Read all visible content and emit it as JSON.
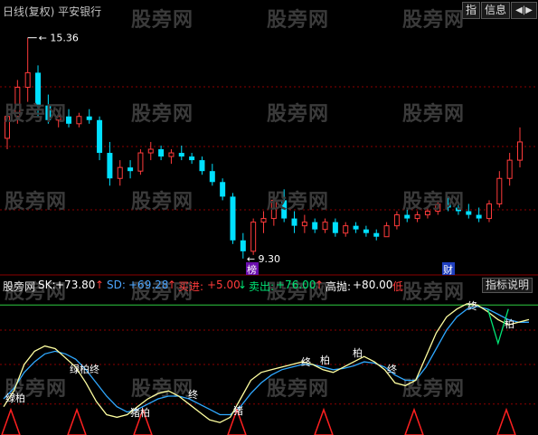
{
  "toolbar": {
    "title": "日线(复权)  平安银行",
    "index_button": "指",
    "info_button": "信息",
    "arrows_button": "◀|▶"
  },
  "watermark": "股旁网",
  "price_chart": {
    "high_label": "15.36",
    "low_label": "9.30",
    "tag_bang": "榜",
    "tag_cai": "财",
    "up_color": "#ff3b3b",
    "down_color": "#00e0ff",
    "candles": [
      [
        12.6,
        13.5,
        12.3,
        13.2
      ],
      [
        13.2,
        14.2,
        13.0,
        14.0
      ],
      [
        14.0,
        15.36,
        13.6,
        14.4
      ],
      [
        14.4,
        14.6,
        13.2,
        13.5
      ],
      [
        13.5,
        13.8,
        13.0,
        13.1
      ],
      [
        13.1,
        13.3,
        12.9,
        13.2
      ],
      [
        13.2,
        13.4,
        12.9,
        13.0
      ],
      [
        13.0,
        13.3,
        12.9,
        13.2
      ],
      [
        13.2,
        13.4,
        13.0,
        13.1
      ],
      [
        13.1,
        13.2,
        12.0,
        12.2
      ],
      [
        12.2,
        12.5,
        11.3,
        11.5
      ],
      [
        11.5,
        12.0,
        11.3,
        11.8
      ],
      [
        11.8,
        12.0,
        11.5,
        11.7
      ],
      [
        11.7,
        12.3,
        11.6,
        12.2
      ],
      [
        12.2,
        12.5,
        12.0,
        12.3
      ],
      [
        12.3,
        12.4,
        12.0,
        12.1
      ],
      [
        12.1,
        12.3,
        11.9,
        12.2
      ],
      [
        12.2,
        12.4,
        12.0,
        12.1
      ],
      [
        12.1,
        12.2,
        11.9,
        12.0
      ],
      [
        12.0,
        12.1,
        11.6,
        11.7
      ],
      [
        11.7,
        11.9,
        11.3,
        11.4
      ],
      [
        11.4,
        11.5,
        10.9,
        11.0
      ],
      [
        11.0,
        11.1,
        9.7,
        9.8
      ],
      [
        9.8,
        10.0,
        9.3,
        9.5
      ],
      [
        9.5,
        10.4,
        9.4,
        10.3
      ],
      [
        10.3,
        10.6,
        10.0,
        10.4
      ],
      [
        10.4,
        11.0,
        10.2,
        10.9
      ],
      [
        10.9,
        11.2,
        10.3,
        10.4
      ],
      [
        10.4,
        10.6,
        10.0,
        10.2
      ],
      [
        10.2,
        10.5,
        10.0,
        10.3
      ],
      [
        10.3,
        10.4,
        10.0,
        10.1
      ],
      [
        10.1,
        10.4,
        10.0,
        10.3
      ],
      [
        10.3,
        10.4,
        9.9,
        10.0
      ],
      [
        10.0,
        10.3,
        9.9,
        10.2
      ],
      [
        10.2,
        10.3,
        10.0,
        10.1
      ],
      [
        10.1,
        10.2,
        9.9,
        10.0
      ],
      [
        10.0,
        10.1,
        9.8,
        9.9
      ],
      [
        9.9,
        10.3,
        9.9,
        10.2
      ],
      [
        10.2,
        10.6,
        10.1,
        10.5
      ],
      [
        10.5,
        10.7,
        10.3,
        10.4
      ],
      [
        10.4,
        10.6,
        10.3,
        10.5
      ],
      [
        10.5,
        10.7,
        10.4,
        10.6
      ],
      [
        10.6,
        10.9,
        10.5,
        10.8
      ],
      [
        10.8,
        11.0,
        10.6,
        10.7
      ],
      [
        10.7,
        10.8,
        10.5,
        10.6
      ],
      [
        10.6,
        10.8,
        10.4,
        10.5
      ],
      [
        10.5,
        10.7,
        10.3,
        10.4
      ],
      [
        10.4,
        10.9,
        10.3,
        10.8
      ],
      [
        10.8,
        11.7,
        10.7,
        11.5
      ],
      [
        11.5,
        12.2,
        11.3,
        12.0
      ],
      [
        12.0,
        12.9,
        11.8,
        12.5
      ]
    ]
  },
  "indicator": {
    "name": "股旁网",
    "sk_label": "SK:",
    "sk_value": "+73.80",
    "sd_label": "SD:",
    "sd_value": "+69.28",
    "buy_label": "买进:",
    "buy_value": "+5.00",
    "sell_label": "卖出:",
    "sell_value": "+76.00",
    "high_label": "高抛:",
    "high_value": "+80.00",
    "low_label": "低",
    "button": "指标说明",
    "signals": [
      "绿柏",
      "绿柏终",
      "猪柏",
      "终",
      "猪",
      "终",
      "柏",
      "柏",
      "终",
      "终",
      "柏"
    ],
    "sk": [
      18,
      30,
      50,
      60,
      64,
      62,
      55,
      48,
      36,
      22,
      12,
      10,
      12,
      18,
      24,
      28,
      30,
      26,
      20,
      14,
      8,
      6,
      10,
      24,
      38,
      44,
      46,
      48,
      50,
      52,
      50,
      46,
      44,
      48,
      52,
      56,
      52,
      46,
      36,
      34,
      38,
      56,
      74,
      86,
      92,
      96,
      95,
      90,
      84,
      80,
      82,
      84
    ],
    "sd": [
      24,
      32,
      44,
      52,
      58,
      60,
      58,
      54,
      46,
      36,
      26,
      18,
      14,
      16,
      20,
      24,
      26,
      26,
      24,
      20,
      16,
      12,
      12,
      18,
      28,
      36,
      42,
      46,
      48,
      50,
      50,
      48,
      46,
      47,
      49,
      52,
      51,
      48,
      42,
      38,
      38,
      48,
      62,
      76,
      86,
      92,
      94,
      92,
      88,
      84,
      82,
      82
    ]
  }
}
